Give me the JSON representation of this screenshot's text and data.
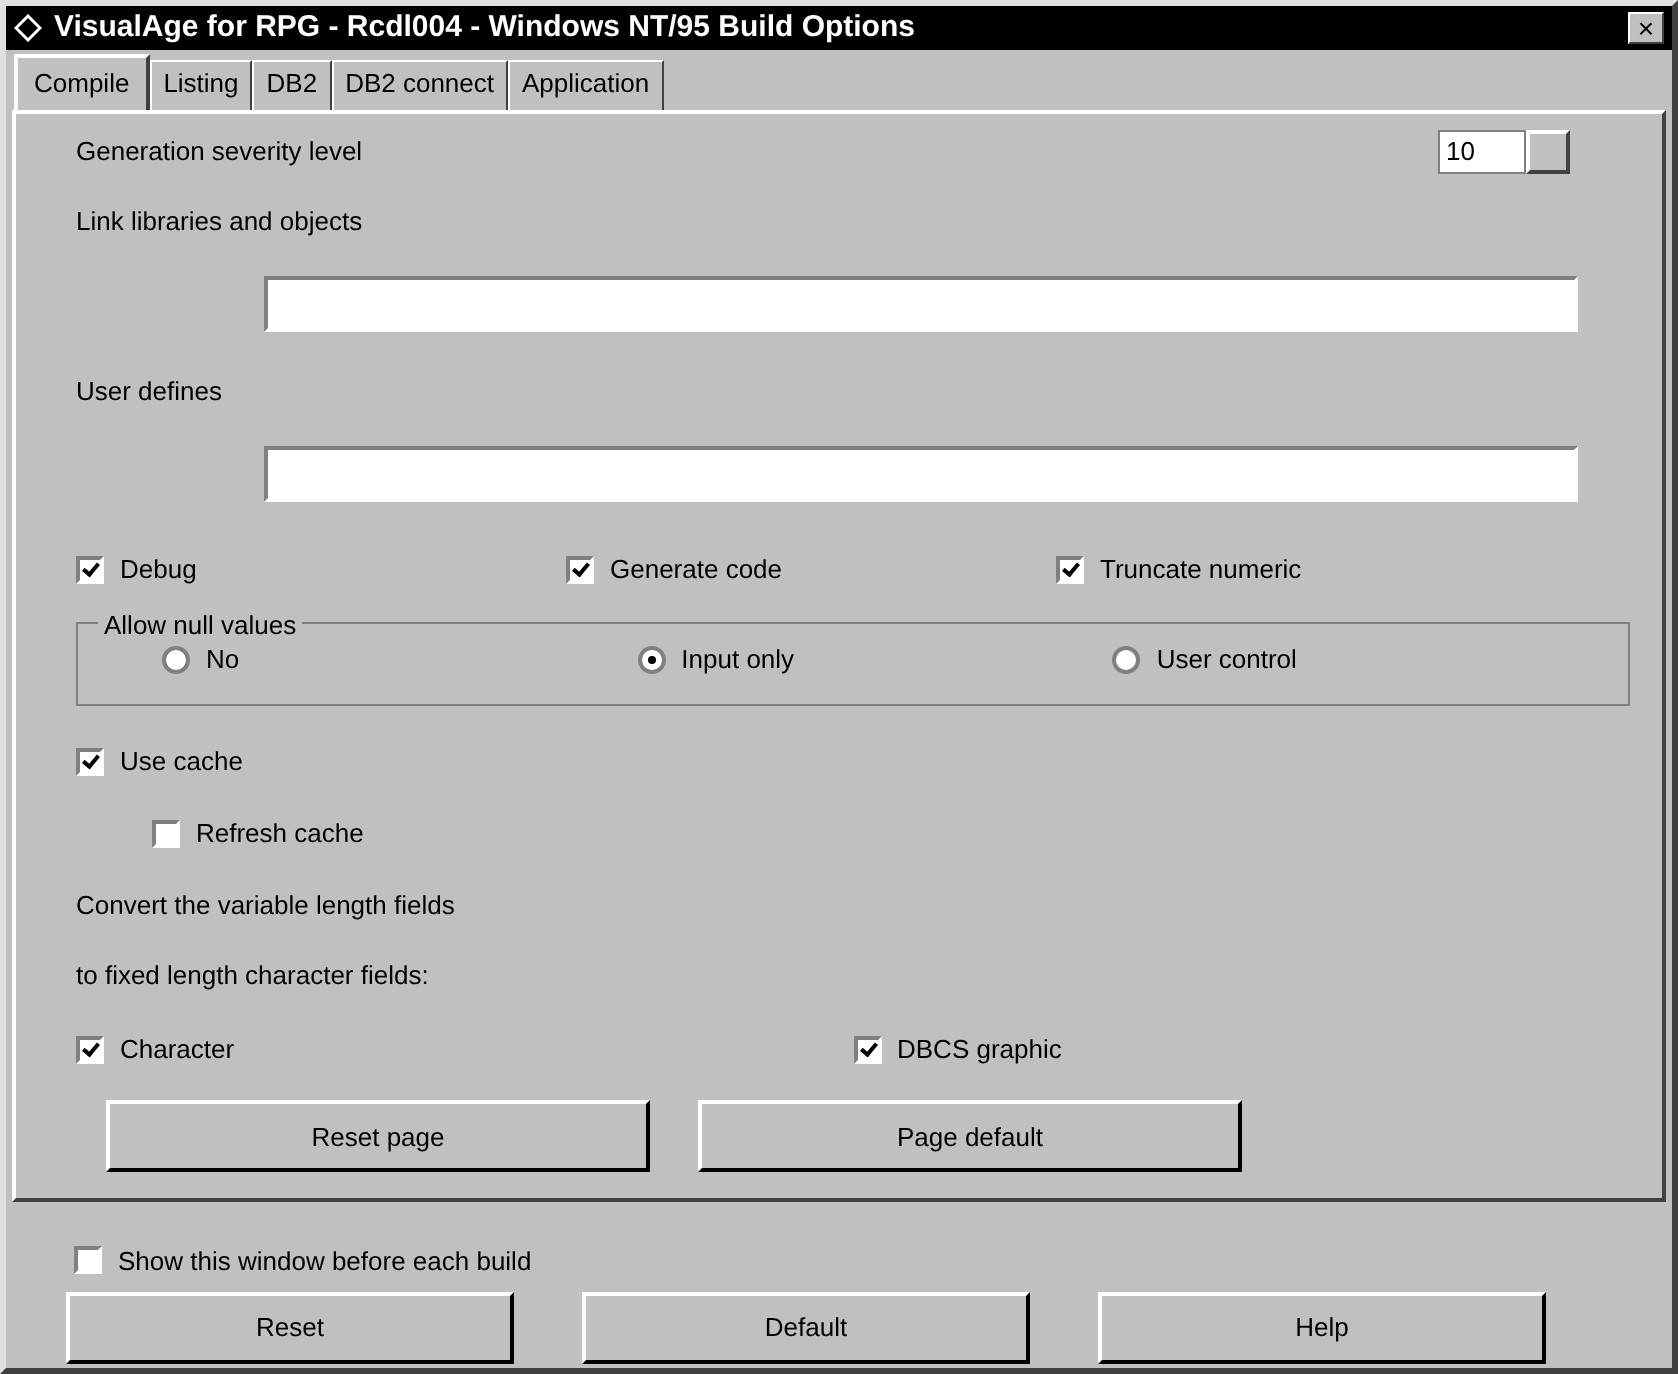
{
  "window": {
    "title": "VisualAge for RPG - Rcdl004 - Windows NT/95 Build Options",
    "close": "×"
  },
  "tabs": [
    {
      "label": "Compile",
      "selected": true
    },
    {
      "label": "Listing",
      "selected": false
    },
    {
      "label": "DB2",
      "selected": false
    },
    {
      "label": "DB2 connect",
      "selected": false
    },
    {
      "label": "Application",
      "selected": false
    }
  ],
  "severity": {
    "label": "Generation severity level",
    "value": "10"
  },
  "fields": [
    {
      "label": "Link libraries and objects"
    },
    {
      "label": "User defines"
    }
  ],
  "options": [
    {
      "label": "Debug",
      "checked": true
    },
    {
      "label": "Generate code",
      "checked": true
    },
    {
      "label": "Truncate numeric",
      "checked": true
    }
  ],
  "null_values": {
    "title": "Allow null values",
    "choices": [
      {
        "label": "No",
        "selected": false
      },
      {
        "label": "Input only",
        "selected": true
      },
      {
        "label": "User control",
        "selected": false
      }
    ]
  },
  "use_cache": {
    "label": "Use cache",
    "checked": true
  },
  "refresh_cache": {
    "label": "Refresh cache",
    "checked": false
  },
  "convert_text": [
    "Convert the variable length fields",
    "to fixed length character fields:"
  ],
  "convert": [
    {
      "label": "Character",
      "checked": true
    },
    {
      "label": "DBCS graphic",
      "checked": true
    }
  ],
  "page_buttons": [
    "Reset page",
    "Page default"
  ],
  "show_window": {
    "label": "Show this window before each build",
    "checked": false
  },
  "buttons": [
    "Reset",
    "Default",
    "Help"
  ]
}
